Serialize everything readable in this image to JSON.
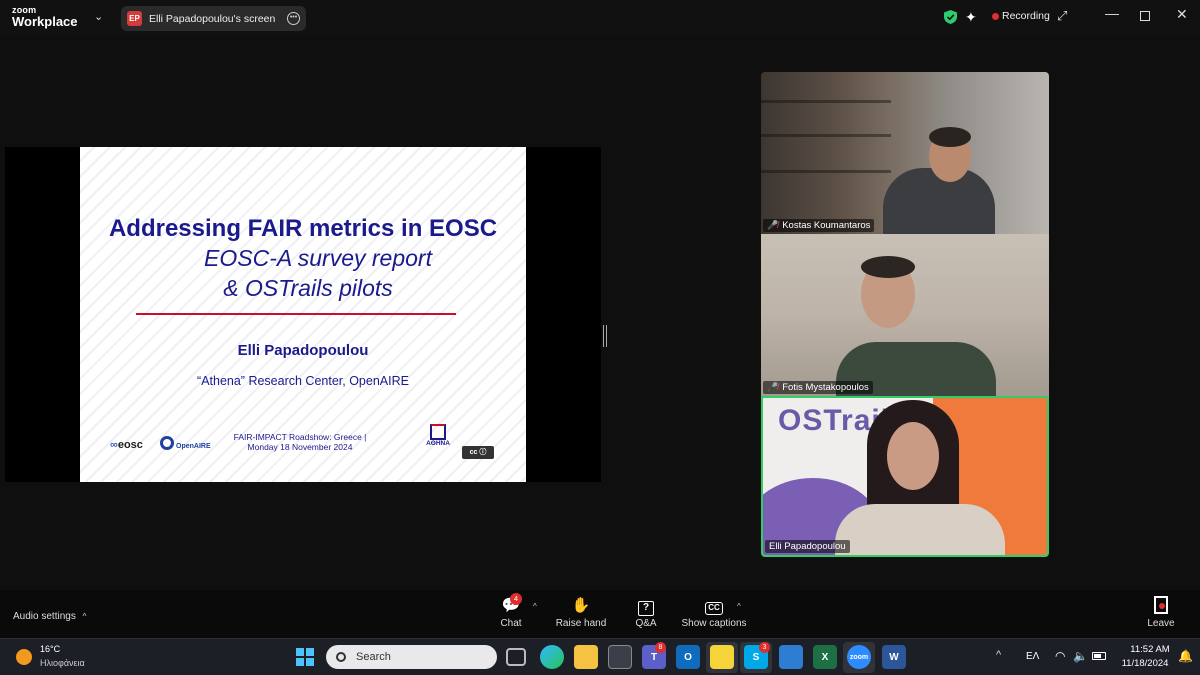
{
  "titlebar": {
    "brand_top": "zoom",
    "brand_bottom": "Workplace",
    "screen_avatar": "EP",
    "screen_label": "Elli Papadopoulou's screen",
    "recording_label": "Recording",
    "shield_color": "#2ecc71",
    "recording_color": "#e02e2e"
  },
  "slide": {
    "title": "Addressing FAIR metrics in EOSC",
    "subtitle_line1": "EOSC-A survey report",
    "subtitle_line2": "& OSTrails pilots",
    "author": "Elli Papadopoulou",
    "affiliation": "“Athena” Research Center, OpenAIRE",
    "event_line1": "FAIR-IMPACT Roadshow: Greece |",
    "event_line2": "Monday 18 November 2024",
    "logo_eosc_symbol": "∞",
    "logo_eosc_text": "eosc",
    "logo_openaire": "OpenAIRE",
    "logo_athena": "AΘHNA",
    "logo_cc": "cc ⓘ",
    "text_color": "#1a1a8c",
    "rule_color": "#c8102e"
  },
  "participants": [
    {
      "name": "Kostas Koumantaros",
      "muted": true
    },
    {
      "name": "Fotis Mystakopoulos",
      "muted": true
    },
    {
      "name": "Elli Papadopoulou",
      "muted": false,
      "speaking": true,
      "background_logo": "OSTrails"
    }
  ],
  "toolbar": {
    "audio_settings": "Audio settings",
    "chat_label": "Chat",
    "chat_badge": "4",
    "raise_hand_label": "Raise hand",
    "qa_label": "Q&A",
    "captions_label": "Show captions",
    "leave_label": "Leave"
  },
  "taskbar": {
    "weather_temp": "16°C",
    "weather_desc": "Ηλιοφάνεια",
    "search_placeholder": "Search",
    "teams_badge": "8",
    "skype_badge": "3",
    "language": "ΕΛ",
    "time": "11:52 AM",
    "date": "11/18/2024"
  }
}
